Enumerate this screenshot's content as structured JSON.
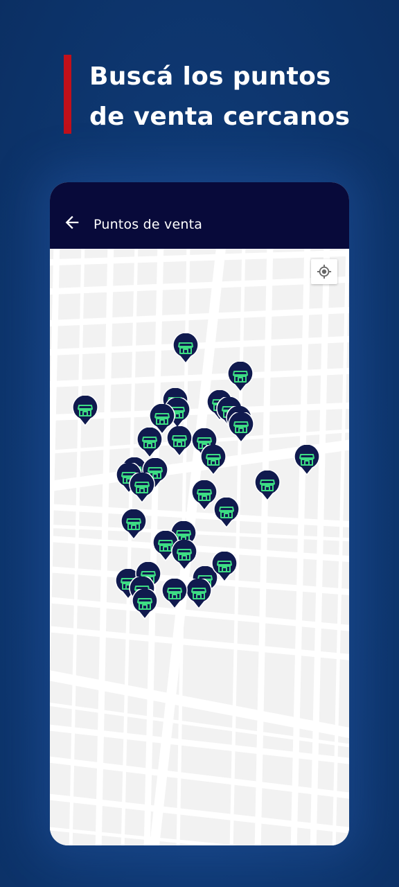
{
  "headline": {
    "line1": "Buscá los puntos",
    "line2": "de venta cercanos"
  },
  "app": {
    "title": "Puntos de venta",
    "back_icon": "arrow-left-icon",
    "locate_icon": "my-location-icon"
  },
  "colors": {
    "background": "#0f3a75",
    "accent": "#c2101a",
    "appbar": "#080a3a",
    "marker_fill": "#101a4e",
    "marker_icon": "#3ddc84"
  },
  "map": {
    "marker_icon": "store-icon",
    "marker_count": 39
  }
}
